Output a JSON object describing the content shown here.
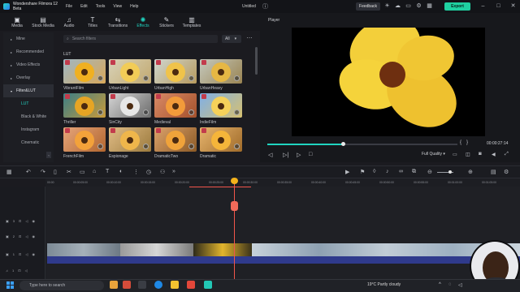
{
  "window": {
    "app_name": "Wondershare Filmora 12 Beta",
    "menu": [
      "File",
      "Edit",
      "Tools",
      "View",
      "Help"
    ],
    "project_title": "Untitled",
    "feedback_label": "Feedback",
    "export_label": "Export"
  },
  "toolbar": {
    "tabs": [
      {
        "label": "Media",
        "icon": "media-icon"
      },
      {
        "label": "Stock Media",
        "icon": "stock-media-icon"
      },
      {
        "label": "Audio",
        "icon": "audio-icon"
      },
      {
        "label": "Titles",
        "icon": "titles-icon"
      },
      {
        "label": "Transitions",
        "icon": "transitions-icon"
      },
      {
        "label": "Effects",
        "icon": "effects-icon",
        "active": true
      },
      {
        "label": "Stickers",
        "icon": "stickers-icon"
      },
      {
        "label": "Templates",
        "icon": "templates-icon"
      }
    ]
  },
  "sidebar": {
    "items": [
      "Mine",
      "Recommended",
      "Video Effects",
      "Overlay",
      "Filter&LUT",
      "LUT",
      "Black & White",
      "Instagram",
      "Cinematic"
    ]
  },
  "browser": {
    "search_placeholder": "Search filters",
    "filter_value": "All",
    "section_label": "LUT",
    "cards": [
      "VibrantFilm",
      "UrbanLight",
      "UrbanHigh",
      "UrbanHeavy",
      "Thriller",
      "SinCity",
      "Medieval",
      "IndieFilm",
      "FrenchFilm",
      "Espionage",
      "DramaticTwo",
      "Dramatic"
    ]
  },
  "player": {
    "label": "Player",
    "timecode": "00:00:27:14",
    "progress": 0.4,
    "quality": "Full Quality"
  },
  "timeline": {
    "ticks": [
      "00:00",
      "00:00:05:00",
      "00:00:10:00",
      "00:00:15:00",
      "00:00:20:00",
      "00:00:25:00",
      "00:00:30:00",
      "00:00:35:00",
      "00:00:40:00",
      "00:00:45:00",
      "00:00:50:00",
      "00:00:55:00",
      "00:01:00:00",
      "00:01:05:00"
    ],
    "tracks": [
      "3",
      "2",
      "1",
      "1"
    ]
  },
  "taskbar": {
    "search_placeholder": "Type here to search",
    "weather": "19°C  Partly cloudy"
  },
  "colors": {
    "accent": "#20d4c0",
    "export": "#1fd1a1",
    "playhead": "#f2554b"
  }
}
